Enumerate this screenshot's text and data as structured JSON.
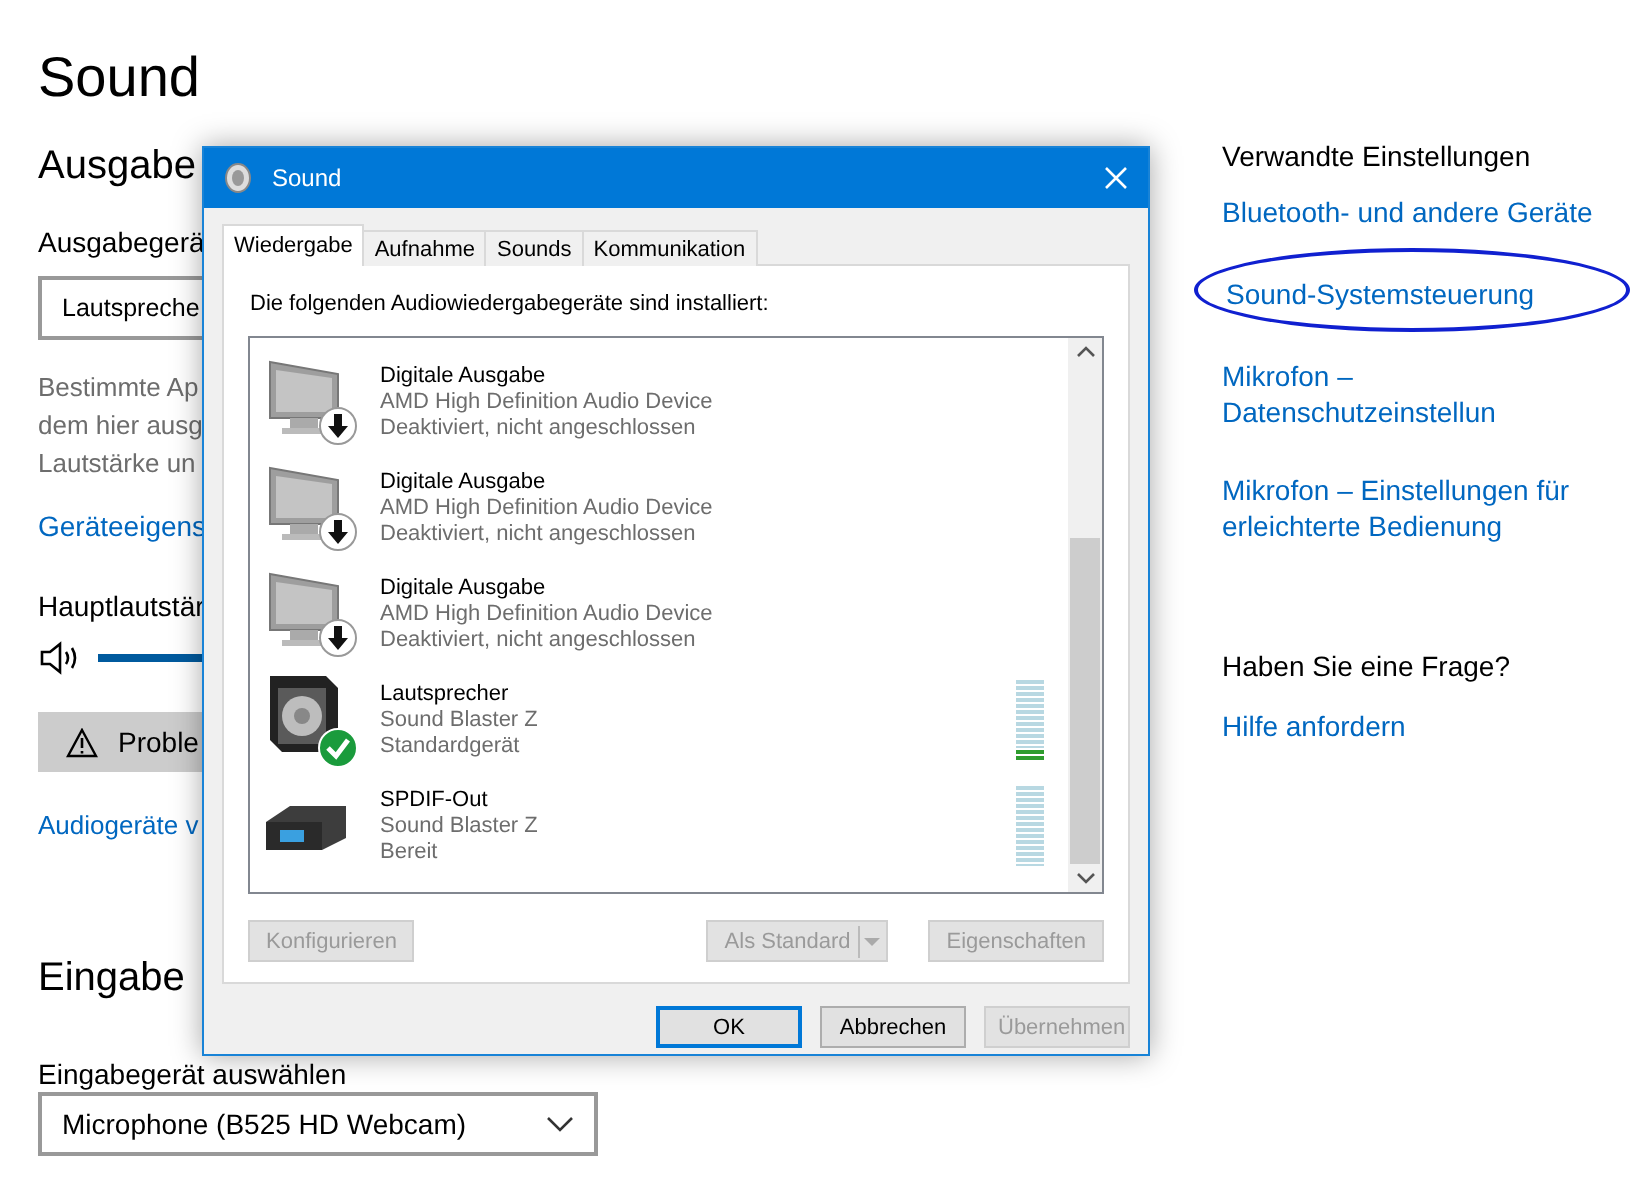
{
  "page": {
    "title": "Sound"
  },
  "output": {
    "heading": "Ausgabe",
    "device_label": "Ausgabegerä",
    "device_value": "Lautspreche",
    "description": [
      "Bestimmte Ap",
      "dem hier ausg",
      "Lautstärke un"
    ],
    "properties_link": "Geräteeigens",
    "volume_label": "Hauptlautstär",
    "troubleshoot_button": "Proble",
    "manage_link": "Audiogeräte v"
  },
  "input": {
    "heading": "Eingabe",
    "device_label": "Eingabegerät auswählen",
    "device_value": "Microphone (B525 HD Webcam)"
  },
  "related": {
    "heading": "Verwandte Einstellungen",
    "links": [
      {
        "label": "Bluetooth- und andere Geräte",
        "highlighted": false
      },
      {
        "label": "Sound-Systemsteuerung",
        "highlighted": true
      },
      {
        "label": "Mikrofon – Datenschutzeinstellun",
        "highlighted": false
      },
      {
        "label": "Mikrofon – Einstellungen für erleichterte Bedienung",
        "highlighted": false
      }
    ]
  },
  "help": {
    "heading": "Haben Sie eine Frage?",
    "link": "Hilfe anfordern"
  },
  "dialog": {
    "title": "Sound",
    "tabs": [
      {
        "label": "Wiedergabe",
        "selected": true
      },
      {
        "label": "Aufnahme",
        "selected": false
      },
      {
        "label": "Sounds",
        "selected": false
      },
      {
        "label": "Kommunikation",
        "selected": false
      }
    ],
    "instruction": "Die folgenden Audiowiedergabegeräte sind installiert:",
    "devices": [
      {
        "kind": "monitor",
        "name": "Digitale Ausgabe",
        "driver": "AMD High Definition Audio Device",
        "status": "Deaktiviert, nicht angeschlossen",
        "disconnected": true,
        "default": false
      },
      {
        "kind": "monitor",
        "name": "Digitale Ausgabe",
        "driver": "AMD High Definition Audio Device",
        "status": "Deaktiviert, nicht angeschlossen",
        "disconnected": true,
        "default": false
      },
      {
        "kind": "monitor",
        "name": "Digitale Ausgabe",
        "driver": "AMD High Definition Audio Device",
        "status": "Deaktiviert, nicht angeschlossen",
        "disconnected": true,
        "default": false
      },
      {
        "kind": "speaker",
        "name": "Lautsprecher",
        "driver": "Sound Blaster Z",
        "status": "Standardgerät",
        "disconnected": false,
        "default": true,
        "level": 0.15
      },
      {
        "kind": "receiver",
        "name": "SPDIF-Out",
        "driver": "Sound Blaster Z",
        "status": "Bereit",
        "disconnected": false,
        "default": false,
        "level": 0
      }
    ],
    "buttons": [
      {
        "kind": "plain",
        "label": "Konfigurieren",
        "disabled": true
      },
      {
        "kind": "split",
        "label": "Als Standard",
        "disabled": true
      },
      {
        "kind": "plain",
        "label": "Eigenschaften",
        "disabled": true
      }
    ],
    "footer_buttons": [
      {
        "label": "OK",
        "disabled": false,
        "focused": true
      },
      {
        "label": "Abbrechen",
        "disabled": false,
        "focused": false
      },
      {
        "label": "Übernehmen",
        "disabled": true,
        "focused": false
      }
    ]
  }
}
